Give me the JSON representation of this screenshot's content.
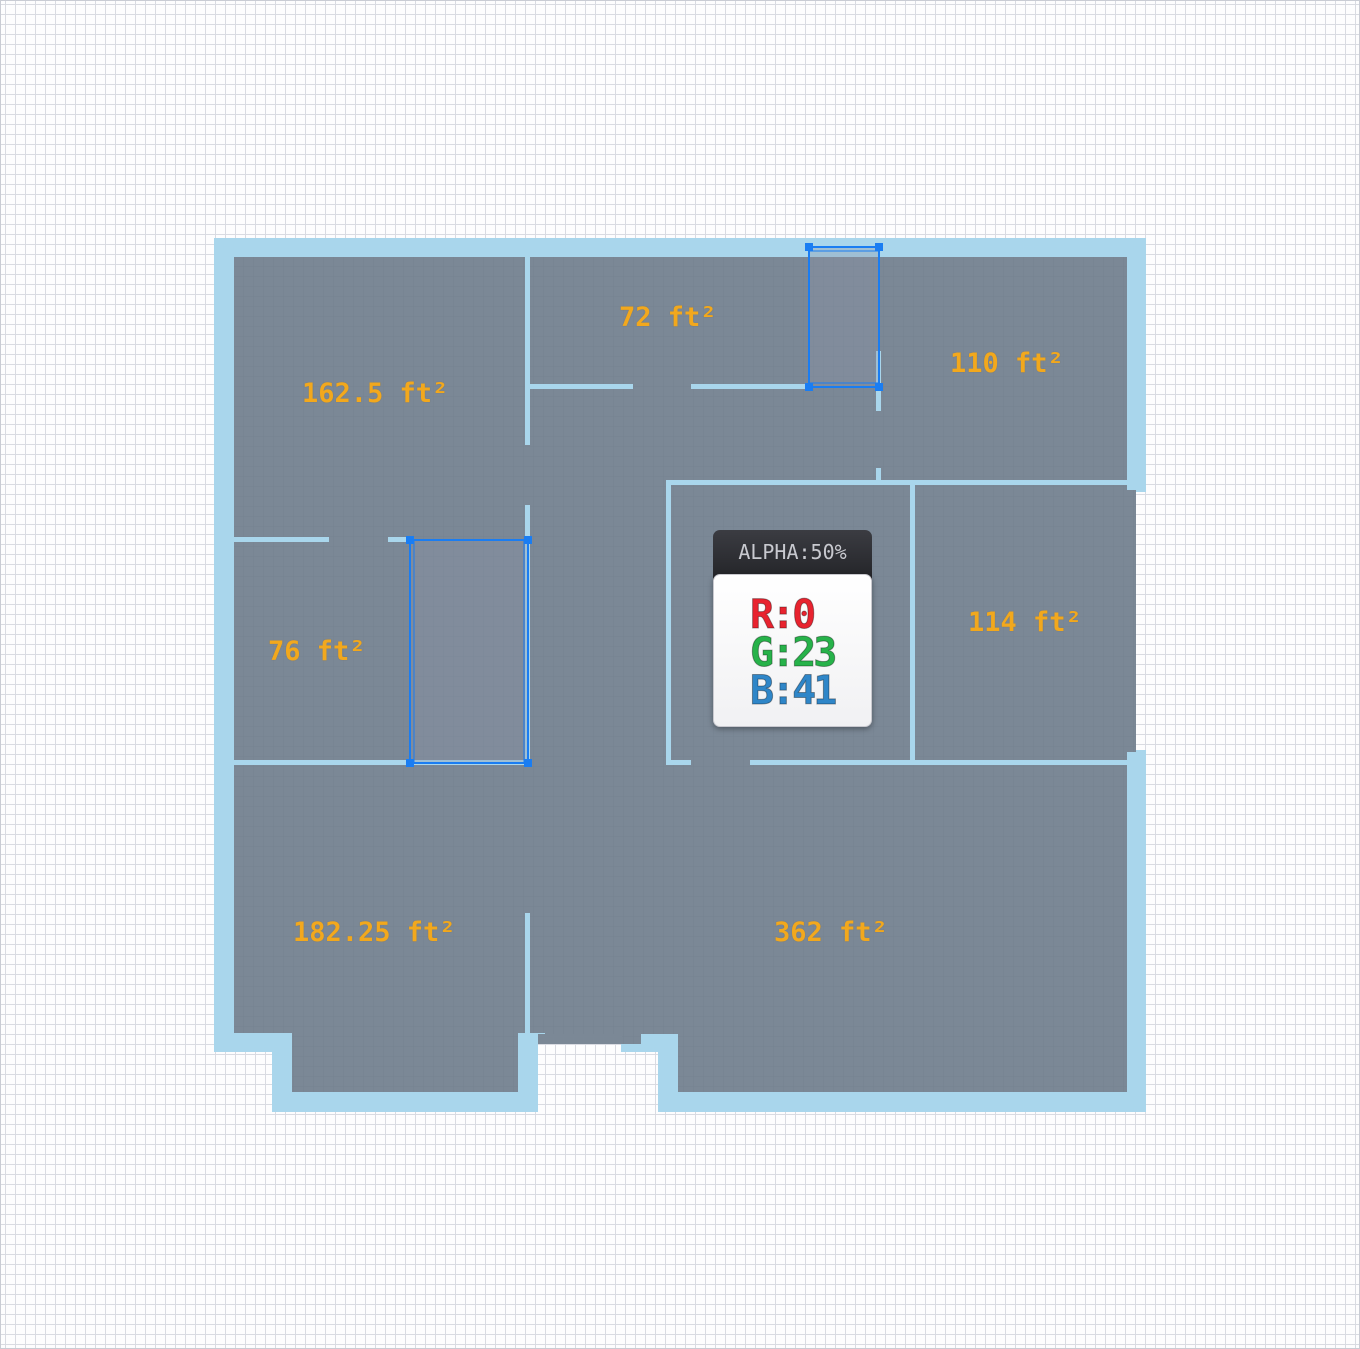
{
  "rooms": [
    {
      "id": "top-left",
      "area_label": "162.5 ft²"
    },
    {
      "id": "top-middle",
      "area_label": "72 ft²"
    },
    {
      "id": "top-right",
      "area_label": "110 ft²"
    },
    {
      "id": "middle-left",
      "area_label": "76 ft²"
    },
    {
      "id": "middle-right",
      "area_label": "114 ft²"
    },
    {
      "id": "bottom-left",
      "area_label": "182.25 ft²"
    },
    {
      "id": "bottom-right",
      "area_label": "362 ft²"
    }
  ],
  "color_tooltip": {
    "alpha_label": "ALPHA:50%",
    "r_label": "R:0",
    "g_label": "G:23",
    "b_label": "B:41"
  },
  "colors": {
    "wall": "#a9d6ec",
    "floor": "#7b8896",
    "selection": "#1a7df2",
    "area_label": "#f2a81d",
    "r_color": "#e8232f",
    "g_color": "#27b24a",
    "b_color": "#2f86c8"
  }
}
